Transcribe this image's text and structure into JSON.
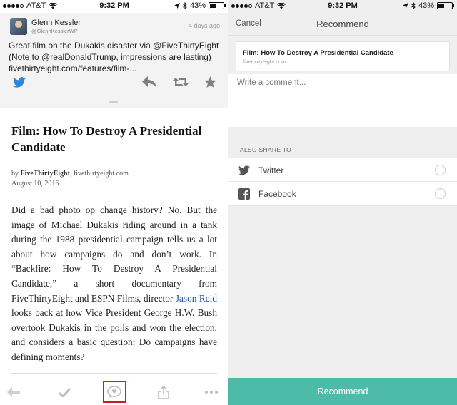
{
  "status_left": {
    "carrier": "AT&T",
    "time": "9:32 PM",
    "battery": "43%",
    "battery_level": 0.43
  },
  "status_right": {
    "carrier": "AT&T",
    "time": "9:32 PM",
    "battery": "43%",
    "battery_level": 0.43
  },
  "tweet": {
    "author_name": "Glenn Kessler",
    "author_handle": "@GlennKesslerWP",
    "time_ago": "4 days ago",
    "text": "Great film on the Dukakis disaster via @FiveThirtyEight (Note to @realDonaldTrump, impressions are lasting) fivethirtyeight.com/features/film-...",
    "icons": [
      "twitter-icon",
      "reply-icon",
      "retweet-icon",
      "favorite-icon"
    ]
  },
  "article": {
    "title": "Film: How To Destroy A Presidential Candidate",
    "by_prefix": "by",
    "author": "FiveThirtyEight",
    "source": ", fivethirtyeight.com",
    "date": "August 10, 2016",
    "body_part1": "Did a bad photo op change history? No. But the image of Michael Dukakis riding around in a tank during the 1988 presidential campaign tells us a lot about how campaigns do and don’t work. In “Backfire: How To Destroy A Presidential Candidate,” a short documentary from FiveThirtyEight and ESPN Films, director ",
    "link_text": "Jason Reid",
    "body_part2": " looks back at how Vice President George H.W. Bush overtook Dukakis in the polls and won the election, and considers a basic question: Do campaigns have defining moments?"
  },
  "toolbar": {
    "icons": [
      "back-arrow-icon",
      "checkmark-icon",
      "recommend-icon",
      "share-icon",
      "more-icon"
    ],
    "highlight_color": "#d01b1b"
  },
  "recommend": {
    "cancel_label": "Cancel",
    "title": "Recommend",
    "card_title": "Film: How To Destroy A Presidential Candidate",
    "card_domain": "fivethirtyeight.com",
    "comment_placeholder": "Write a comment...",
    "also_share_label": "ALSO SHARE TO",
    "share_options": [
      {
        "label": "Twitter",
        "icon": "twitter-icon"
      },
      {
        "label": "Facebook",
        "icon": "facebook-icon"
      }
    ],
    "button_label": "Recommend",
    "button_color": "#4dbba7"
  }
}
